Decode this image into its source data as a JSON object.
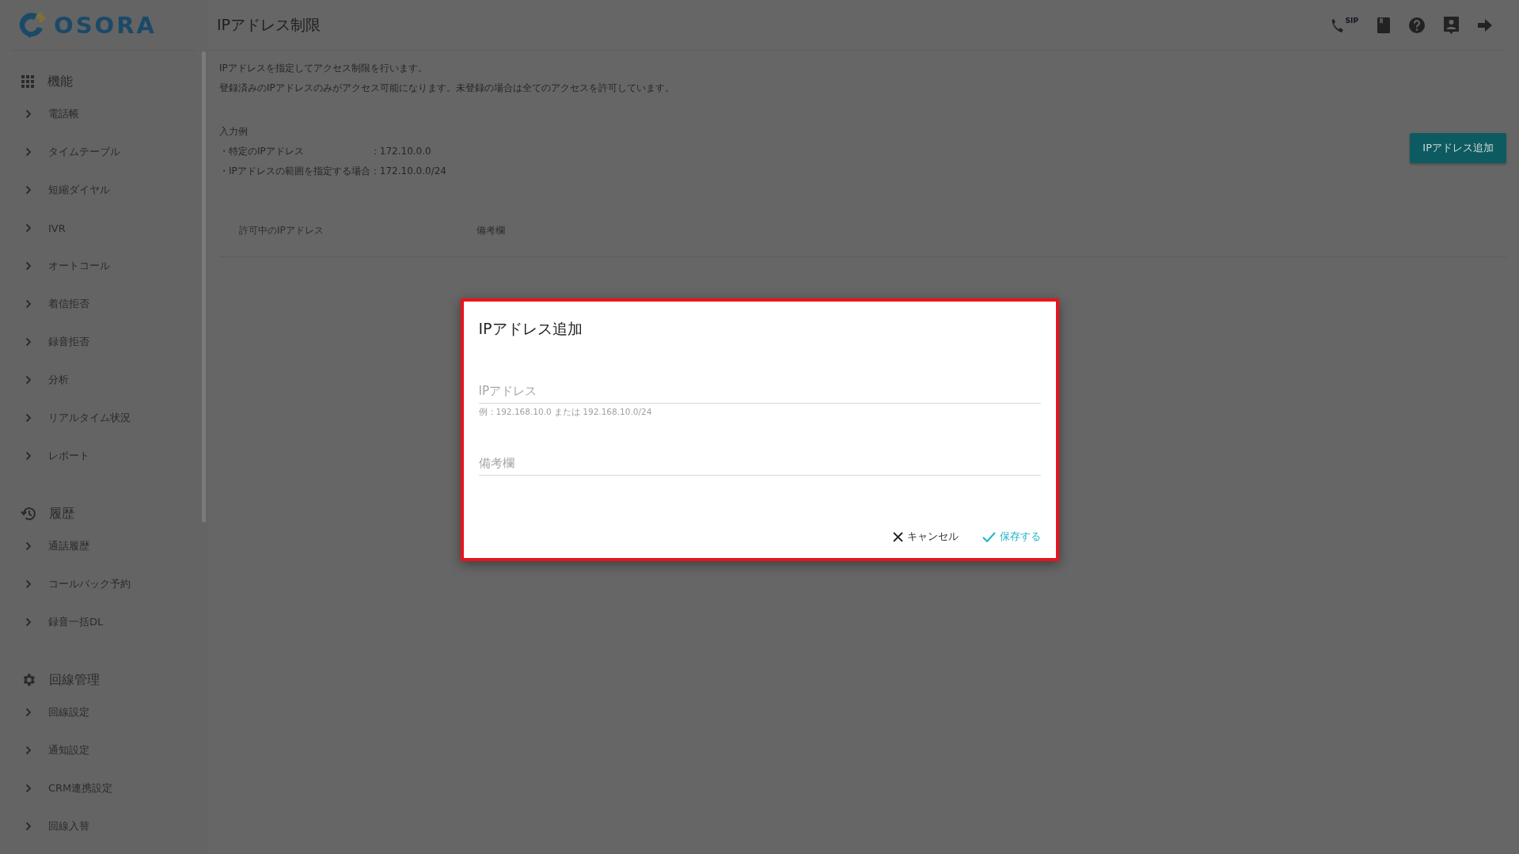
{
  "header": {
    "logo": "OSORA",
    "title": "IPアドレス制限",
    "sip_label": "SIP"
  },
  "sidebar": {
    "sections": [
      {
        "title": "機能",
        "items": [
          {
            "label": "電話帳"
          },
          {
            "label": "タイムテーブル"
          },
          {
            "label": "短縮ダイヤル"
          },
          {
            "label": "IVR"
          },
          {
            "label": "オートコール"
          },
          {
            "label": "着信拒否"
          },
          {
            "label": "録音拒否"
          },
          {
            "label": "分析"
          },
          {
            "label": "リアルタイム状況"
          },
          {
            "label": "レポート"
          }
        ]
      },
      {
        "title": "履歴",
        "items": [
          {
            "label": "通話履歴"
          },
          {
            "label": "コールバック予約"
          },
          {
            "label": "録音一括DL"
          }
        ]
      },
      {
        "title": "回線管理",
        "items": [
          {
            "label": "回線設定"
          },
          {
            "label": "通知設定"
          },
          {
            "label": "CRM連携設定"
          },
          {
            "label": "回線入替"
          }
        ]
      }
    ]
  },
  "main": {
    "description": [
      "IPアドレスを指定してアクセス制限を行います。",
      "登録済みのIPアドレスのみがアクセス可能になります。未登録の場合は全てのアクセスを許可しています。"
    ],
    "example": {
      "heading": "入力例",
      "rows": [
        {
          "label": "・特定のIPアドレス",
          "value": "：172.10.0.0"
        },
        {
          "label": "・IPアドレスの範囲を指定する場合",
          "value": "：172.10.0.0/24"
        }
      ]
    },
    "add_button": "IPアドレス追加",
    "table": {
      "columns": [
        "許可中のIPアドレス",
        "備考欄"
      ]
    }
  },
  "dialog": {
    "title": "IPアドレス追加",
    "fields": [
      {
        "placeholder": "IPアドレス",
        "hint": "例：192.168.10.0 または 192.168.10.0/24"
      },
      {
        "placeholder": "備考欄"
      }
    ],
    "buttons": [
      {
        "label": "キャンセル",
        "kind": "cancel"
      },
      {
        "label": "保存する",
        "kind": "confirm"
      }
    ]
  }
}
